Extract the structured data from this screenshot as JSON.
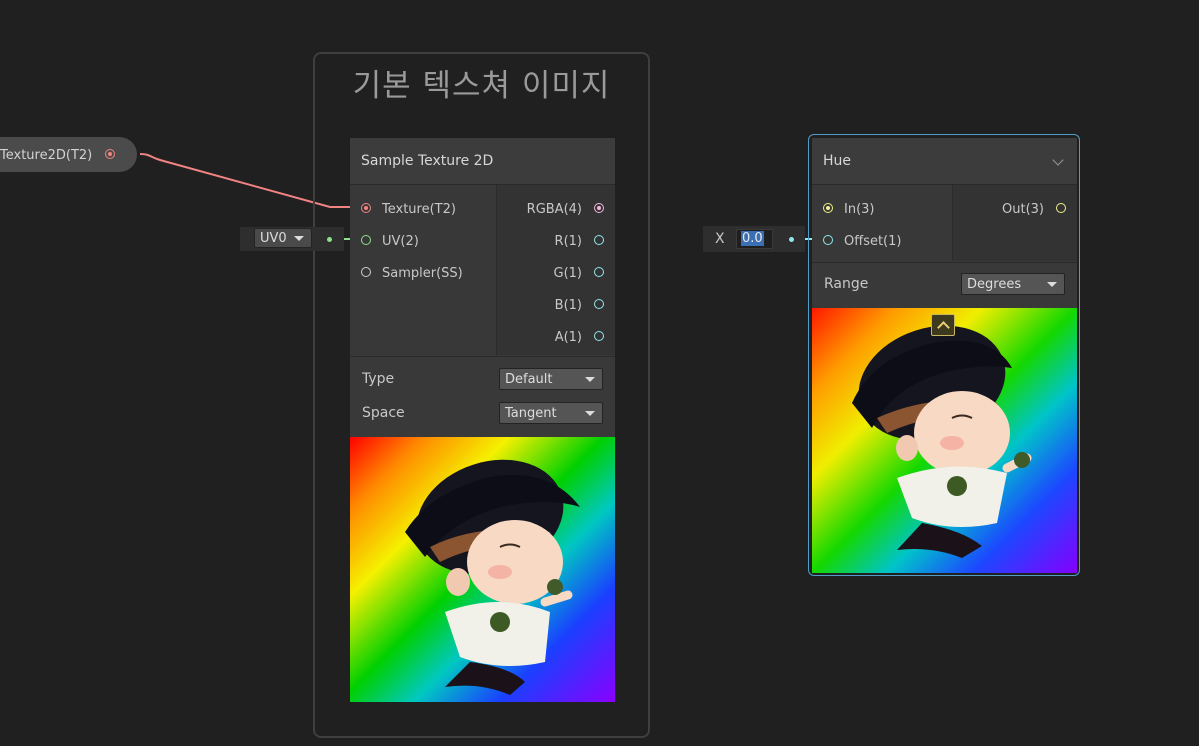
{
  "group": {
    "title": "기본 텍스쳐 이미지"
  },
  "property_node": {
    "label": "Texture2D(T2)"
  },
  "uv_input": {
    "value": "UV0"
  },
  "sample_texture": {
    "title": "Sample Texture 2D",
    "inputs": [
      "Texture(T2)",
      "UV(2)",
      "Sampler(SS)"
    ],
    "outputs": [
      "RGBA(4)",
      "R(1)",
      "G(1)",
      "B(1)",
      "A(1)"
    ],
    "type_label": "Type",
    "type_value": "Default",
    "space_label": "Space",
    "space_value": "Tangent"
  },
  "offset_input": {
    "axis": "X",
    "value": "0.0"
  },
  "hue": {
    "title": "Hue",
    "inputs": [
      "In(3)",
      "Offset(1)"
    ],
    "output": "Out(3)",
    "range_label": "Range",
    "range_value": "Degrees"
  },
  "colors": {
    "texture_port": "#f28383",
    "vector2_port": "#8be28b",
    "sampler_port": "#d0d0d0",
    "vector4_port": "#f5b4dc",
    "float_port": "#8ee8ea",
    "vector3_port": "#f2ef8c",
    "selection": "#4f9cc8"
  },
  "icons": [
    "collapse-chevron-icon",
    "dropdown-arrow-icon",
    "preview-expand-icon"
  ]
}
